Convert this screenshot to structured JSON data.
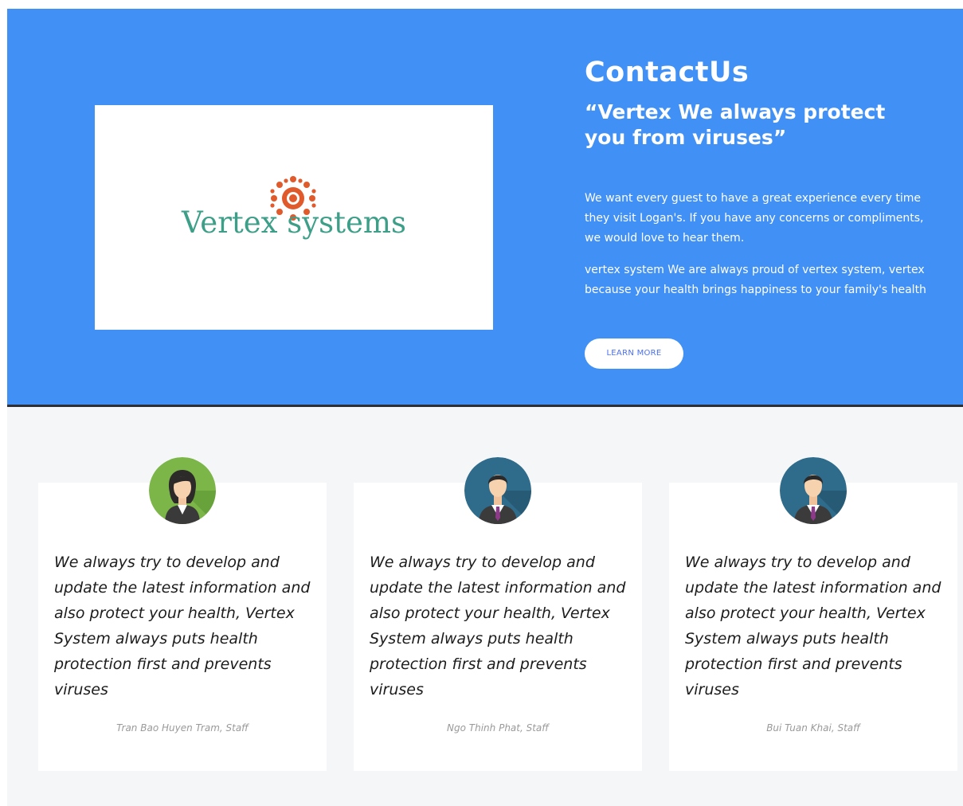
{
  "hero": {
    "logo": {
      "text": "Vertex systems",
      "icon": "virus-icon",
      "text_color": "#3d9f88",
      "icon_color": "#e05a2b"
    },
    "title": "ContactUs",
    "quote": "“Vertex We always protect you from viruses”",
    "paragraph1": "We want every guest to have a great experience every time they visit Logan's. If you have any concerns or compliments, we would love to hear them.",
    "paragraph2": "vertex system We are always proud of vertex system, vertex because your health brings happiness to your family's health",
    "button_label": "LEARN MORE",
    "background_color": "#4190f5"
  },
  "team": {
    "cards": [
      {
        "avatar": "female-staff-avatar-icon",
        "quote": "We always try to develop and update the latest information and also protect your health, Vertex System always puts health protection first and prevents viruses",
        "author": "Tran Bao Huyen Tram, Staff"
      },
      {
        "avatar": "male-staff-avatar-icon",
        "quote": "We always try to develop and update the latest information and also protect your health, Vertex System always puts health protection first and prevents viruses",
        "author": "Ngo Thinh Phat, Staff"
      },
      {
        "avatar": "male-staff-avatar-icon",
        "quote": "We always try to develop and update the latest information and also protect your health, Vertex System always puts health protection first and prevents viruses",
        "author": "Bui Tuan Khai, Staff"
      }
    ]
  }
}
